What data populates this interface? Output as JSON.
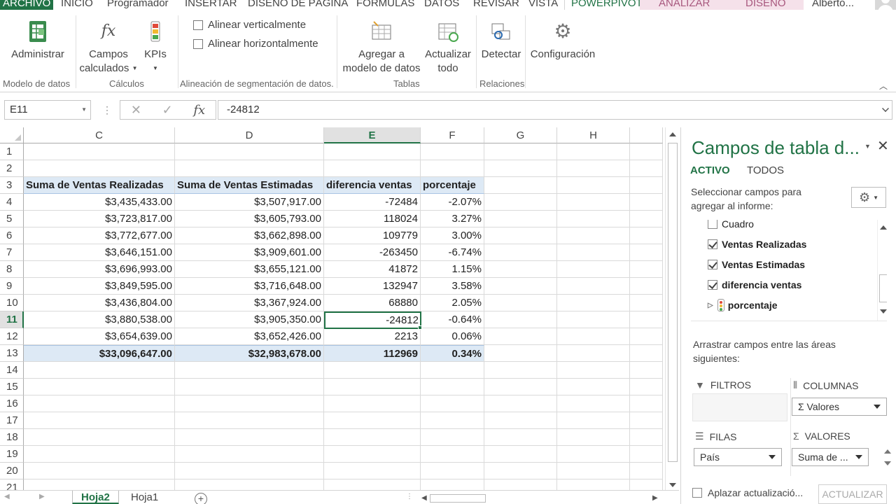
{
  "menu_tabs": [
    "ARCHIVO",
    "INICIO",
    "Programador",
    "INSERTAR",
    "DISEÑO DE PÁGINA",
    "FÓRMULAS",
    "DATOS",
    "REVISAR",
    "VISTA",
    "POWERPIVOT",
    "ANALIZAR",
    "DISEÑO"
  ],
  "user": "Alberto...",
  "ribbon": {
    "administrar": "Administrar",
    "campos_1": "Campos",
    "campos_2": "calculados",
    "kpis": "KPIs",
    "alinear_v": "Alinear verticalmente",
    "alinear_h": "Alinear horizontalmente",
    "agregar_1": "Agregar a",
    "agregar_2": "modelo de datos",
    "actualizar_1": "Actualizar",
    "actualizar_2": "todo",
    "detectar": "Detectar",
    "configuracion": "Configuración",
    "groups": [
      "Modelo de datos",
      "Cálculos",
      "Alineación de segmentación de datos.",
      "Tablas",
      "Relaciones"
    ]
  },
  "formula_bar": {
    "name_box": "E11",
    "fx": "fx",
    "value": "-24812"
  },
  "columns": [
    "C",
    "D",
    "E",
    "F",
    "G",
    "H"
  ],
  "selected_column": "E",
  "rows": [
    "1",
    "2",
    "3",
    "4",
    "5",
    "6",
    "7",
    "8",
    "9",
    "10",
    "11",
    "12",
    "13",
    "14",
    "15",
    "16",
    "17",
    "18",
    "19",
    "20",
    "21"
  ],
  "selected_row": "11",
  "table": {
    "headers": [
      "Suma de Ventas Realizadas",
      "Suma de Ventas Estimadas",
      "diferencia ventas",
      "porcentaje"
    ],
    "rows": [
      [
        "$3,435,433.00",
        "$3,507,917.00",
        "-72484",
        "-2.07%"
      ],
      [
        "$3,723,817.00",
        "$3,605,793.00",
        "118024",
        "3.27%"
      ],
      [
        "$3,772,677.00",
        "$3,662,898.00",
        "109779",
        "3.00%"
      ],
      [
        "$3,646,151.00",
        "$3,909,601.00",
        "-263450",
        "-6.74%"
      ],
      [
        "$3,696,993.00",
        "$3,655,121.00",
        "41872",
        "1.15%"
      ],
      [
        "$3,849,595.00",
        "$3,716,648.00",
        "132947",
        "3.58%"
      ],
      [
        "$3,436,804.00",
        "$3,367,924.00",
        "68880",
        "2.05%"
      ],
      [
        "$3,880,538.00",
        "$3,905,350.00",
        "-24812",
        "-0.64%"
      ],
      [
        "$3,654,639.00",
        "$3,652,426.00",
        "2213",
        "0.06%"
      ]
    ],
    "total": [
      "$33,096,647.00",
      "$32,983,678.00",
      "112969",
      "0.34%"
    ]
  },
  "sheets": {
    "active": "Hoja2",
    "other": "Hoja1"
  },
  "pane": {
    "title": "Campos de tabla d...",
    "tab_active": "ACTIVO",
    "tab_all": "TODOS",
    "instructions": "Seleccionar campos para agregar al informe:",
    "fields": [
      {
        "label": "Cuadro",
        "checked": false
      },
      {
        "label": "Ventas Realizadas",
        "checked": true
      },
      {
        "label": "Ventas Estimadas",
        "checked": true
      },
      {
        "label": "diferencia ventas",
        "checked": true
      },
      {
        "label": "porcentaje",
        "checked": false
      }
    ],
    "drag_instructions": "Arrastrar campos entre las áreas siguientes:",
    "filtros": "FILTROS",
    "columnas": "COLUMNAS",
    "filas": "FILAS",
    "valores": "VALORES",
    "columnas_field": "Valores",
    "filas_field": "País",
    "valores_field": "Suma de ...",
    "defer": "Aplazar actualizació...",
    "update": "ACTUALIZAR"
  },
  "colors": {
    "accent": "#217346",
    "header_fill": "#dde9f5",
    "contextual_tab": "#f5e1ea"
  }
}
